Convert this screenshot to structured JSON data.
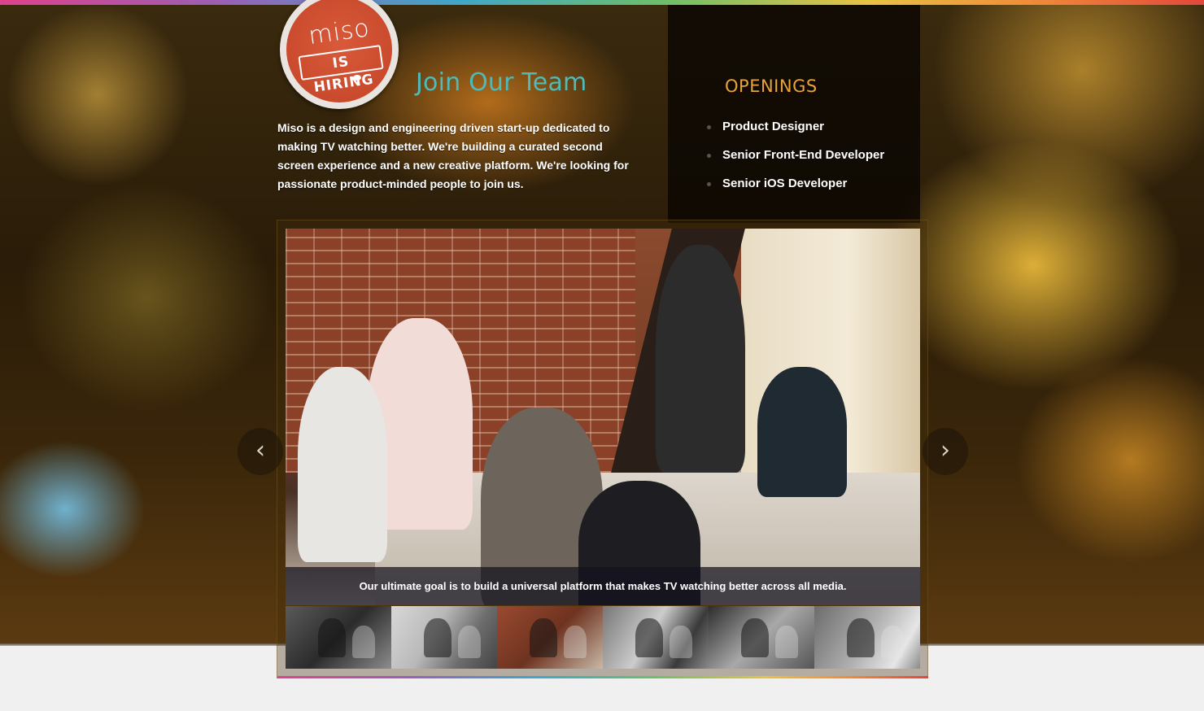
{
  "logo": {
    "word": "miso",
    "badge_text": "IS HIRING"
  },
  "header": {
    "title": "Join Our Team"
  },
  "intro": {
    "text": "Miso is a design and engineering driven start-up dedicated to making TV watching better. We're building a curated second screen experience and a new creative platform. We're looking for passionate product-minded people to join us."
  },
  "openings": {
    "title": "OPENINGS",
    "items": [
      {
        "label": "Product Designer"
      },
      {
        "label": "Senior Front-End Developer"
      },
      {
        "label": "Senior iOS Developer"
      }
    ]
  },
  "slideshow": {
    "caption": "Our ultimate goal is to build a universal platform that makes TV watching better across all media.",
    "prev_icon": "chevron-left-icon",
    "next_icon": "chevron-right-icon",
    "prev_glyph": "‹",
    "next_glyph": "›",
    "thumbnails": [
      "photo",
      "photo",
      "photo",
      "photo",
      "photo",
      "photo"
    ]
  },
  "colors": {
    "title_teal": "#4fbab8",
    "openings_orange": "#e8a33a",
    "badge_red": "#c34327"
  }
}
